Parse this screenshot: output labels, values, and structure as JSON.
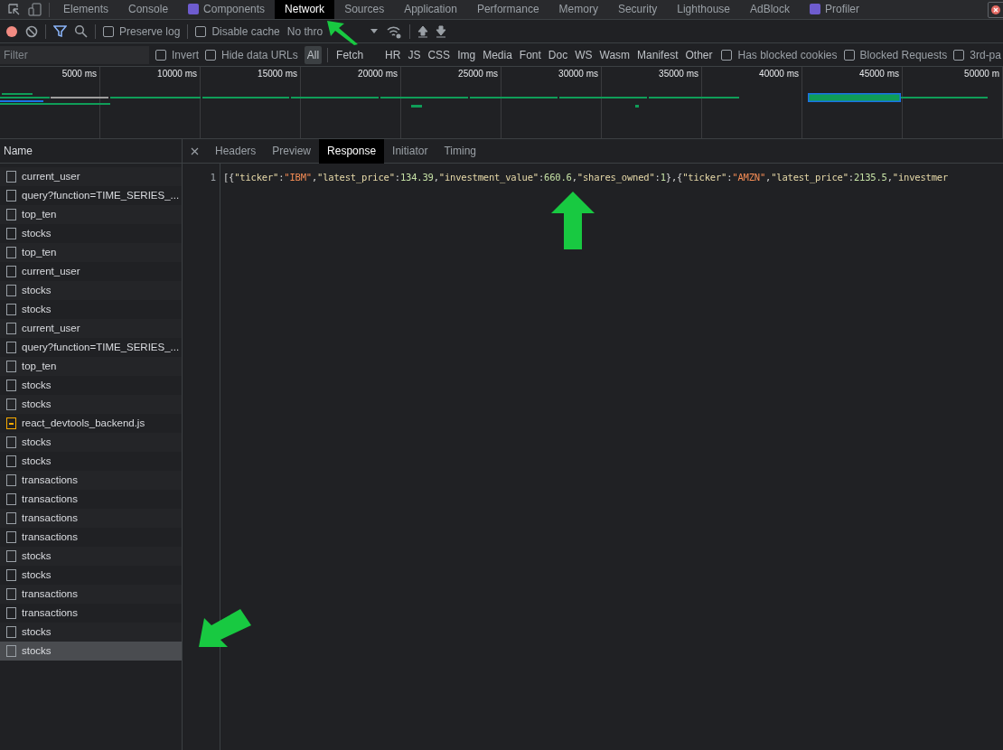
{
  "panel_tabs": [
    {
      "label": "Elements",
      "selected": false,
      "react": false
    },
    {
      "label": "Console",
      "selected": false,
      "react": false
    },
    {
      "label": "Components",
      "selected": false,
      "react": true
    },
    {
      "label": "Network",
      "selected": true,
      "react": false
    },
    {
      "label": "Sources",
      "selected": false,
      "react": false
    },
    {
      "label": "Application",
      "selected": false,
      "react": false
    },
    {
      "label": "Performance",
      "selected": false,
      "react": false
    },
    {
      "label": "Memory",
      "selected": false,
      "react": false
    },
    {
      "label": "Security",
      "selected": false,
      "react": false
    },
    {
      "label": "Lighthouse",
      "selected": false,
      "react": false
    },
    {
      "label": "AdBlock",
      "selected": false,
      "react": false
    },
    {
      "label": "Profiler",
      "selected": false,
      "react": true
    }
  ],
  "toolbar": {
    "preserve_log": {
      "label": "Preserve log",
      "checked": false
    },
    "disable_cache": {
      "label": "Disable cache",
      "checked": false
    },
    "throttling": "No thro"
  },
  "filter_bar": {
    "placeholder": "Filter",
    "invert": {
      "label": "Invert",
      "checked": false
    },
    "hide_data_urls": {
      "label": "Hide data URLs",
      "checked": false
    },
    "types": [
      {
        "label": "All",
        "selected": true
      },
      {
        "label": "Fetch",
        "selected": false
      },
      {
        "label": "HR",
        "selected": false
      },
      {
        "label": "JS",
        "selected": false
      },
      {
        "label": "CSS",
        "selected": false
      },
      {
        "label": "Img",
        "selected": false
      },
      {
        "label": "Media",
        "selected": false
      },
      {
        "label": "Font",
        "selected": false
      },
      {
        "label": "Doc",
        "selected": false
      },
      {
        "label": "WS",
        "selected": false
      },
      {
        "label": "Wasm",
        "selected": false
      },
      {
        "label": "Manifest",
        "selected": false
      },
      {
        "label": "Other",
        "selected": false
      }
    ],
    "options": [
      {
        "label": "Has blocked cookies",
        "checked": false
      },
      {
        "label": "Blocked Requests",
        "checked": false
      },
      {
        "label": "3rd-pa",
        "checked": false
      }
    ]
  },
  "timeline": {
    "ticks": [
      "5000 ms",
      "10000 ms",
      "15000 ms",
      "20000 ms",
      "25000 ms",
      "30000 ms",
      "35000 ms",
      "40000 ms",
      "45000 ms",
      "50000 m"
    ]
  },
  "requests": {
    "header": "Name",
    "rows": [
      {
        "name": "current_user",
        "kind": "doc",
        "selected": false
      },
      {
        "name": "query?function=TIME_SERIES_...",
        "kind": "doc",
        "selected": false
      },
      {
        "name": "top_ten",
        "kind": "doc",
        "selected": false
      },
      {
        "name": "stocks",
        "kind": "doc",
        "selected": false
      },
      {
        "name": "top_ten",
        "kind": "doc",
        "selected": false
      },
      {
        "name": "current_user",
        "kind": "doc",
        "selected": false
      },
      {
        "name": "stocks",
        "kind": "doc",
        "selected": false
      },
      {
        "name": "stocks",
        "kind": "doc",
        "selected": false
      },
      {
        "name": "current_user",
        "kind": "doc",
        "selected": false
      },
      {
        "name": "query?function=TIME_SERIES_...",
        "kind": "doc",
        "selected": false
      },
      {
        "name": "top_ten",
        "kind": "doc",
        "selected": false
      },
      {
        "name": "stocks",
        "kind": "doc",
        "selected": false
      },
      {
        "name": "stocks",
        "kind": "doc",
        "selected": false
      },
      {
        "name": "react_devtools_backend.js",
        "kind": "script",
        "selected": false
      },
      {
        "name": "stocks",
        "kind": "doc",
        "selected": false
      },
      {
        "name": "stocks",
        "kind": "doc",
        "selected": false
      },
      {
        "name": "transactions",
        "kind": "doc",
        "selected": false
      },
      {
        "name": "transactions",
        "kind": "doc",
        "selected": false
      },
      {
        "name": "transactions",
        "kind": "doc",
        "selected": false
      },
      {
        "name": "transactions",
        "kind": "doc",
        "selected": false
      },
      {
        "name": "stocks",
        "kind": "doc",
        "selected": false
      },
      {
        "name": "stocks",
        "kind": "doc",
        "selected": false
      },
      {
        "name": "transactions",
        "kind": "doc",
        "selected": false
      },
      {
        "name": "transactions",
        "kind": "doc",
        "selected": false
      },
      {
        "name": "stocks",
        "kind": "doc",
        "selected": false
      },
      {
        "name": "stocks",
        "kind": "doc",
        "selected": true
      }
    ]
  },
  "detail_tabs": [
    {
      "label": "Headers",
      "selected": false
    },
    {
      "label": "Preview",
      "selected": false
    },
    {
      "label": "Response",
      "selected": true
    },
    {
      "label": "Initiator",
      "selected": false
    },
    {
      "label": "Timing",
      "selected": false
    }
  ],
  "response": {
    "line_number": "1",
    "tokens": [
      {
        "kind": "punct",
        "text": "[{"
      },
      {
        "kind": "key",
        "text": "\"ticker\""
      },
      {
        "kind": "punct",
        "text": ":"
      },
      {
        "kind": "string",
        "text": "\"IBM\""
      },
      {
        "kind": "punct",
        "text": ","
      },
      {
        "kind": "key",
        "text": "\"latest_price\""
      },
      {
        "kind": "punct",
        "text": ":"
      },
      {
        "kind": "number",
        "text": "134.39"
      },
      {
        "kind": "punct",
        "text": ","
      },
      {
        "kind": "key",
        "text": "\"investment_value\""
      },
      {
        "kind": "punct",
        "text": ":"
      },
      {
        "kind": "number",
        "text": "660.6"
      },
      {
        "kind": "punct",
        "text": ","
      },
      {
        "kind": "key",
        "text": "\"shares_owned\""
      },
      {
        "kind": "punct",
        "text": ":"
      },
      {
        "kind": "number",
        "text": "1"
      },
      {
        "kind": "punct",
        "text": "},{"
      },
      {
        "kind": "key",
        "text": "\"ticker\""
      },
      {
        "kind": "punct",
        "text": ":"
      },
      {
        "kind": "string",
        "text": "\"AMZN\""
      },
      {
        "kind": "punct",
        "text": ","
      },
      {
        "kind": "key",
        "text": "\"latest_price\""
      },
      {
        "kind": "punct",
        "text": ":"
      },
      {
        "kind": "number",
        "text": "2135.5"
      },
      {
        "kind": "punct",
        "text": ","
      },
      {
        "kind": "key",
        "text": "\"investmer"
      }
    ]
  }
}
